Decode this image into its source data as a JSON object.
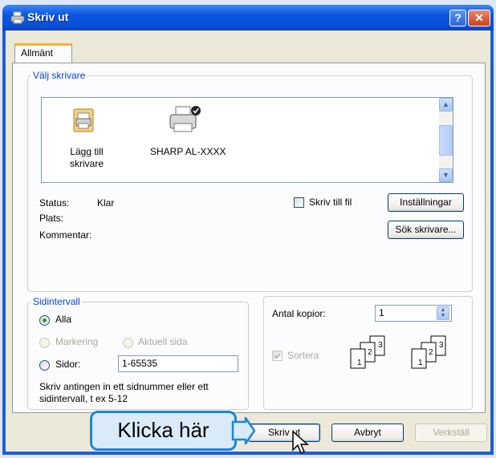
{
  "window": {
    "title": "Skriv ut",
    "help_label": "?",
    "close_label": "✕"
  },
  "tabs": [
    {
      "label": "Allmänt",
      "selected": true
    }
  ],
  "printer_group": {
    "legend": "Välj skrivare",
    "printers": [
      {
        "label_line1": "Lägg till",
        "label_line2": "skrivare",
        "icon": "add-printer-icon"
      },
      {
        "label": "SHARP AL-XXXX",
        "icon": "printer-icon",
        "default": true
      }
    ],
    "status_label": "Status:",
    "status_value": "Klar",
    "location_label": "Plats:",
    "location_value": "",
    "comment_label": "Kommentar:",
    "comment_value": "",
    "print_to_file_label": "Skriv till fil",
    "print_to_file_checked": false,
    "preferences_button": "Inställningar",
    "find_printer_button": "Sök skrivare..."
  },
  "page_range": {
    "legend": "Sidintervall",
    "all_label": "Alla",
    "all_selected": true,
    "selection_label": "Markering",
    "current_page_label": "Aktuell sida",
    "pages_label": "Sidor:",
    "pages_value": "1-65535",
    "hint_line1": "Skriv antingen in ett sidnummer eller ett",
    "hint_line2": "sidintervall, t ex 5-12"
  },
  "copies": {
    "label": "Antal kopior:",
    "value": "1",
    "collate_label": "Sortera",
    "collate_checked": true,
    "collate_pages": [
      "1",
      "2",
      "3"
    ]
  },
  "buttons": {
    "print": "Skriv ut",
    "cancel": "Avbryt",
    "apply": "Verkställ"
  },
  "callout": {
    "text": "Klicka här"
  },
  "colors": {
    "titlebar": "#0a56e0",
    "legend": "#0046d5",
    "callout_border": "#1a87d6",
    "callout_fill": "#d9ebf8"
  }
}
